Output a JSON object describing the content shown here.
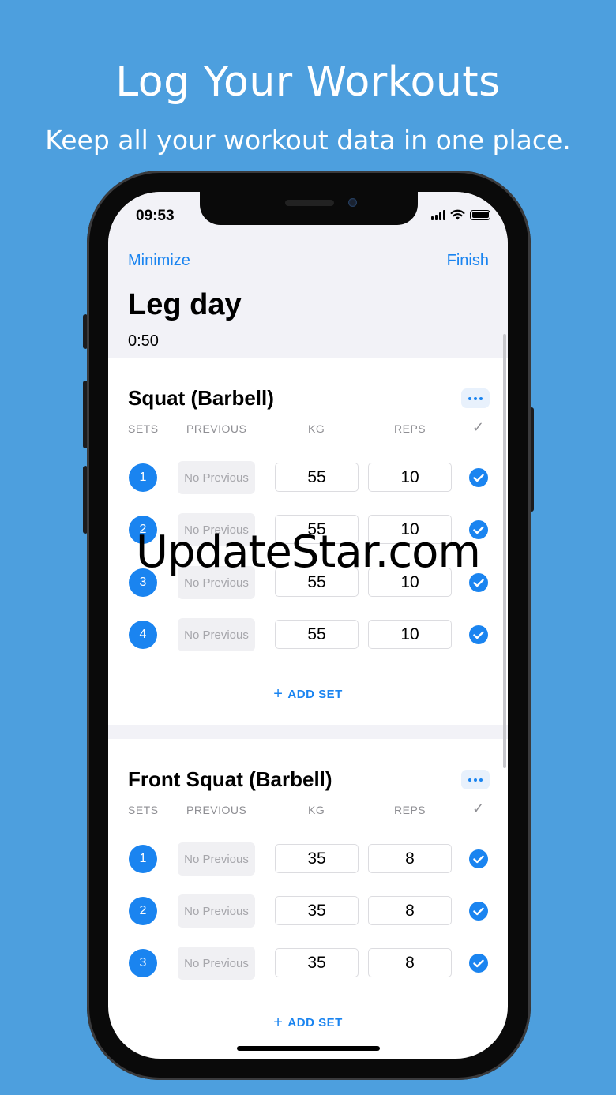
{
  "promo": {
    "title": "Log Your Workouts",
    "subtitle": "Keep all your workout data in one place."
  },
  "status_bar": {
    "time": "09:53",
    "icons": [
      "signal-icon",
      "wifi-icon",
      "battery-icon"
    ]
  },
  "nav": {
    "left_label": "Minimize",
    "right_label": "Finish"
  },
  "workout": {
    "title": "Leg day",
    "timer": "0:50"
  },
  "columns": {
    "sets": "SETS",
    "previous": "PREVIOUS",
    "kg": "KG",
    "reps": "REPS",
    "done": "✓"
  },
  "exercises": [
    {
      "name": "Squat (Barbell)",
      "add_set_label": "ADD SET",
      "sets": [
        {
          "num": "1",
          "previous": "No Previous",
          "kg": "55",
          "reps": "10",
          "done": true
        },
        {
          "num": "2",
          "previous": "No Previous",
          "kg": "55",
          "reps": "10",
          "done": true
        },
        {
          "num": "3",
          "previous": "No Previous",
          "kg": "55",
          "reps": "10",
          "done": true
        },
        {
          "num": "4",
          "previous": "No Previous",
          "kg": "55",
          "reps": "10",
          "done": true
        }
      ]
    },
    {
      "name": "Front Squat (Barbell)",
      "add_set_label": "ADD SET",
      "sets": [
        {
          "num": "1",
          "previous": "No Previous",
          "kg": "35",
          "reps": "8",
          "done": true
        },
        {
          "num": "2",
          "previous": "No Previous",
          "kg": "35",
          "reps": "8",
          "done": true
        },
        {
          "num": "3",
          "previous": "No Previous",
          "kg": "35",
          "reps": "8",
          "done": true
        }
      ]
    }
  ],
  "watermark": "UpdateStar.com",
  "colors": {
    "background": "#4d9fde",
    "accent": "#1a84f0",
    "header_bg": "#f2f2f7"
  }
}
